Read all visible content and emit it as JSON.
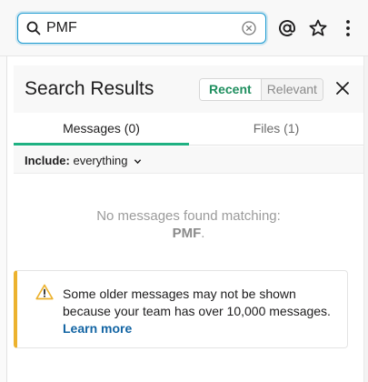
{
  "search": {
    "query": "PMF"
  },
  "panel": {
    "title": "Search Results",
    "sort": {
      "recent": "Recent",
      "relevant": "Relevant"
    },
    "tabs": {
      "messages": "Messages (0)",
      "files": "Files (1)"
    },
    "filter": {
      "label": "Include:",
      "value": "everything"
    },
    "empty": {
      "line1": "No messages found matching:",
      "query": "PMF",
      "suffix": "."
    },
    "warning": {
      "text": "Some older messages may not be shown because your team has over 10,000 messages.",
      "link": "Learn more"
    }
  },
  "colors": {
    "accent_green": "#1fb182",
    "focus_blue": "#1d9bd1",
    "warning_yellow": "#ecb22e",
    "link_blue": "#1264a3"
  },
  "icons": [
    "search-icon",
    "clear-icon",
    "mention-icon",
    "star-icon",
    "more-vertical-icon",
    "close-icon",
    "chevron-down-icon",
    "warning-icon"
  ]
}
